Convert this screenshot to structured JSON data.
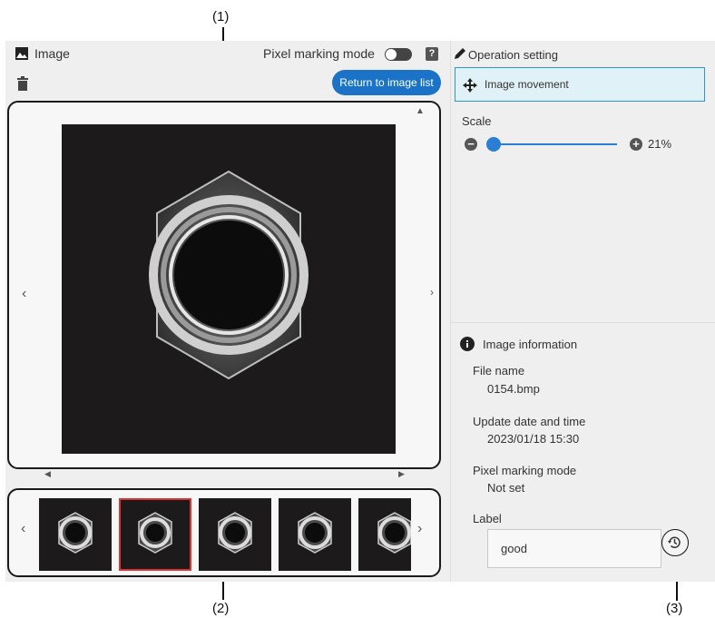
{
  "callouts": {
    "c1": "(1)",
    "c2": "(2)",
    "c3": "(3)"
  },
  "image_panel": {
    "title": "Image",
    "pixel_marking_label": "Pixel marking mode",
    "help_glyph": "?",
    "return_button": "Return to image list",
    "icons": [
      "image-icon",
      "trash-icon",
      "help-icon",
      "chevron-left-icon",
      "chevron-right-icon"
    ]
  },
  "operation": {
    "title": "Operation setting",
    "mode": "Image movement",
    "scale_label": "Scale",
    "scale_value": "21%",
    "scale_level": 0.21
  },
  "info": {
    "title": "Image information",
    "file_name_label": "File name",
    "file_name": "0154.bmp",
    "update_label": "Update date and time",
    "update_value": "2023/01/18 15:30",
    "pixel_mode_label": "Pixel marking mode",
    "pixel_mode_value": "Not set",
    "label_label": "Label",
    "label_value": "good"
  },
  "colors": {
    "accent": "#1a73c7",
    "selected_border": "#dd3333",
    "op_box_bg": "#e1f1f8"
  }
}
